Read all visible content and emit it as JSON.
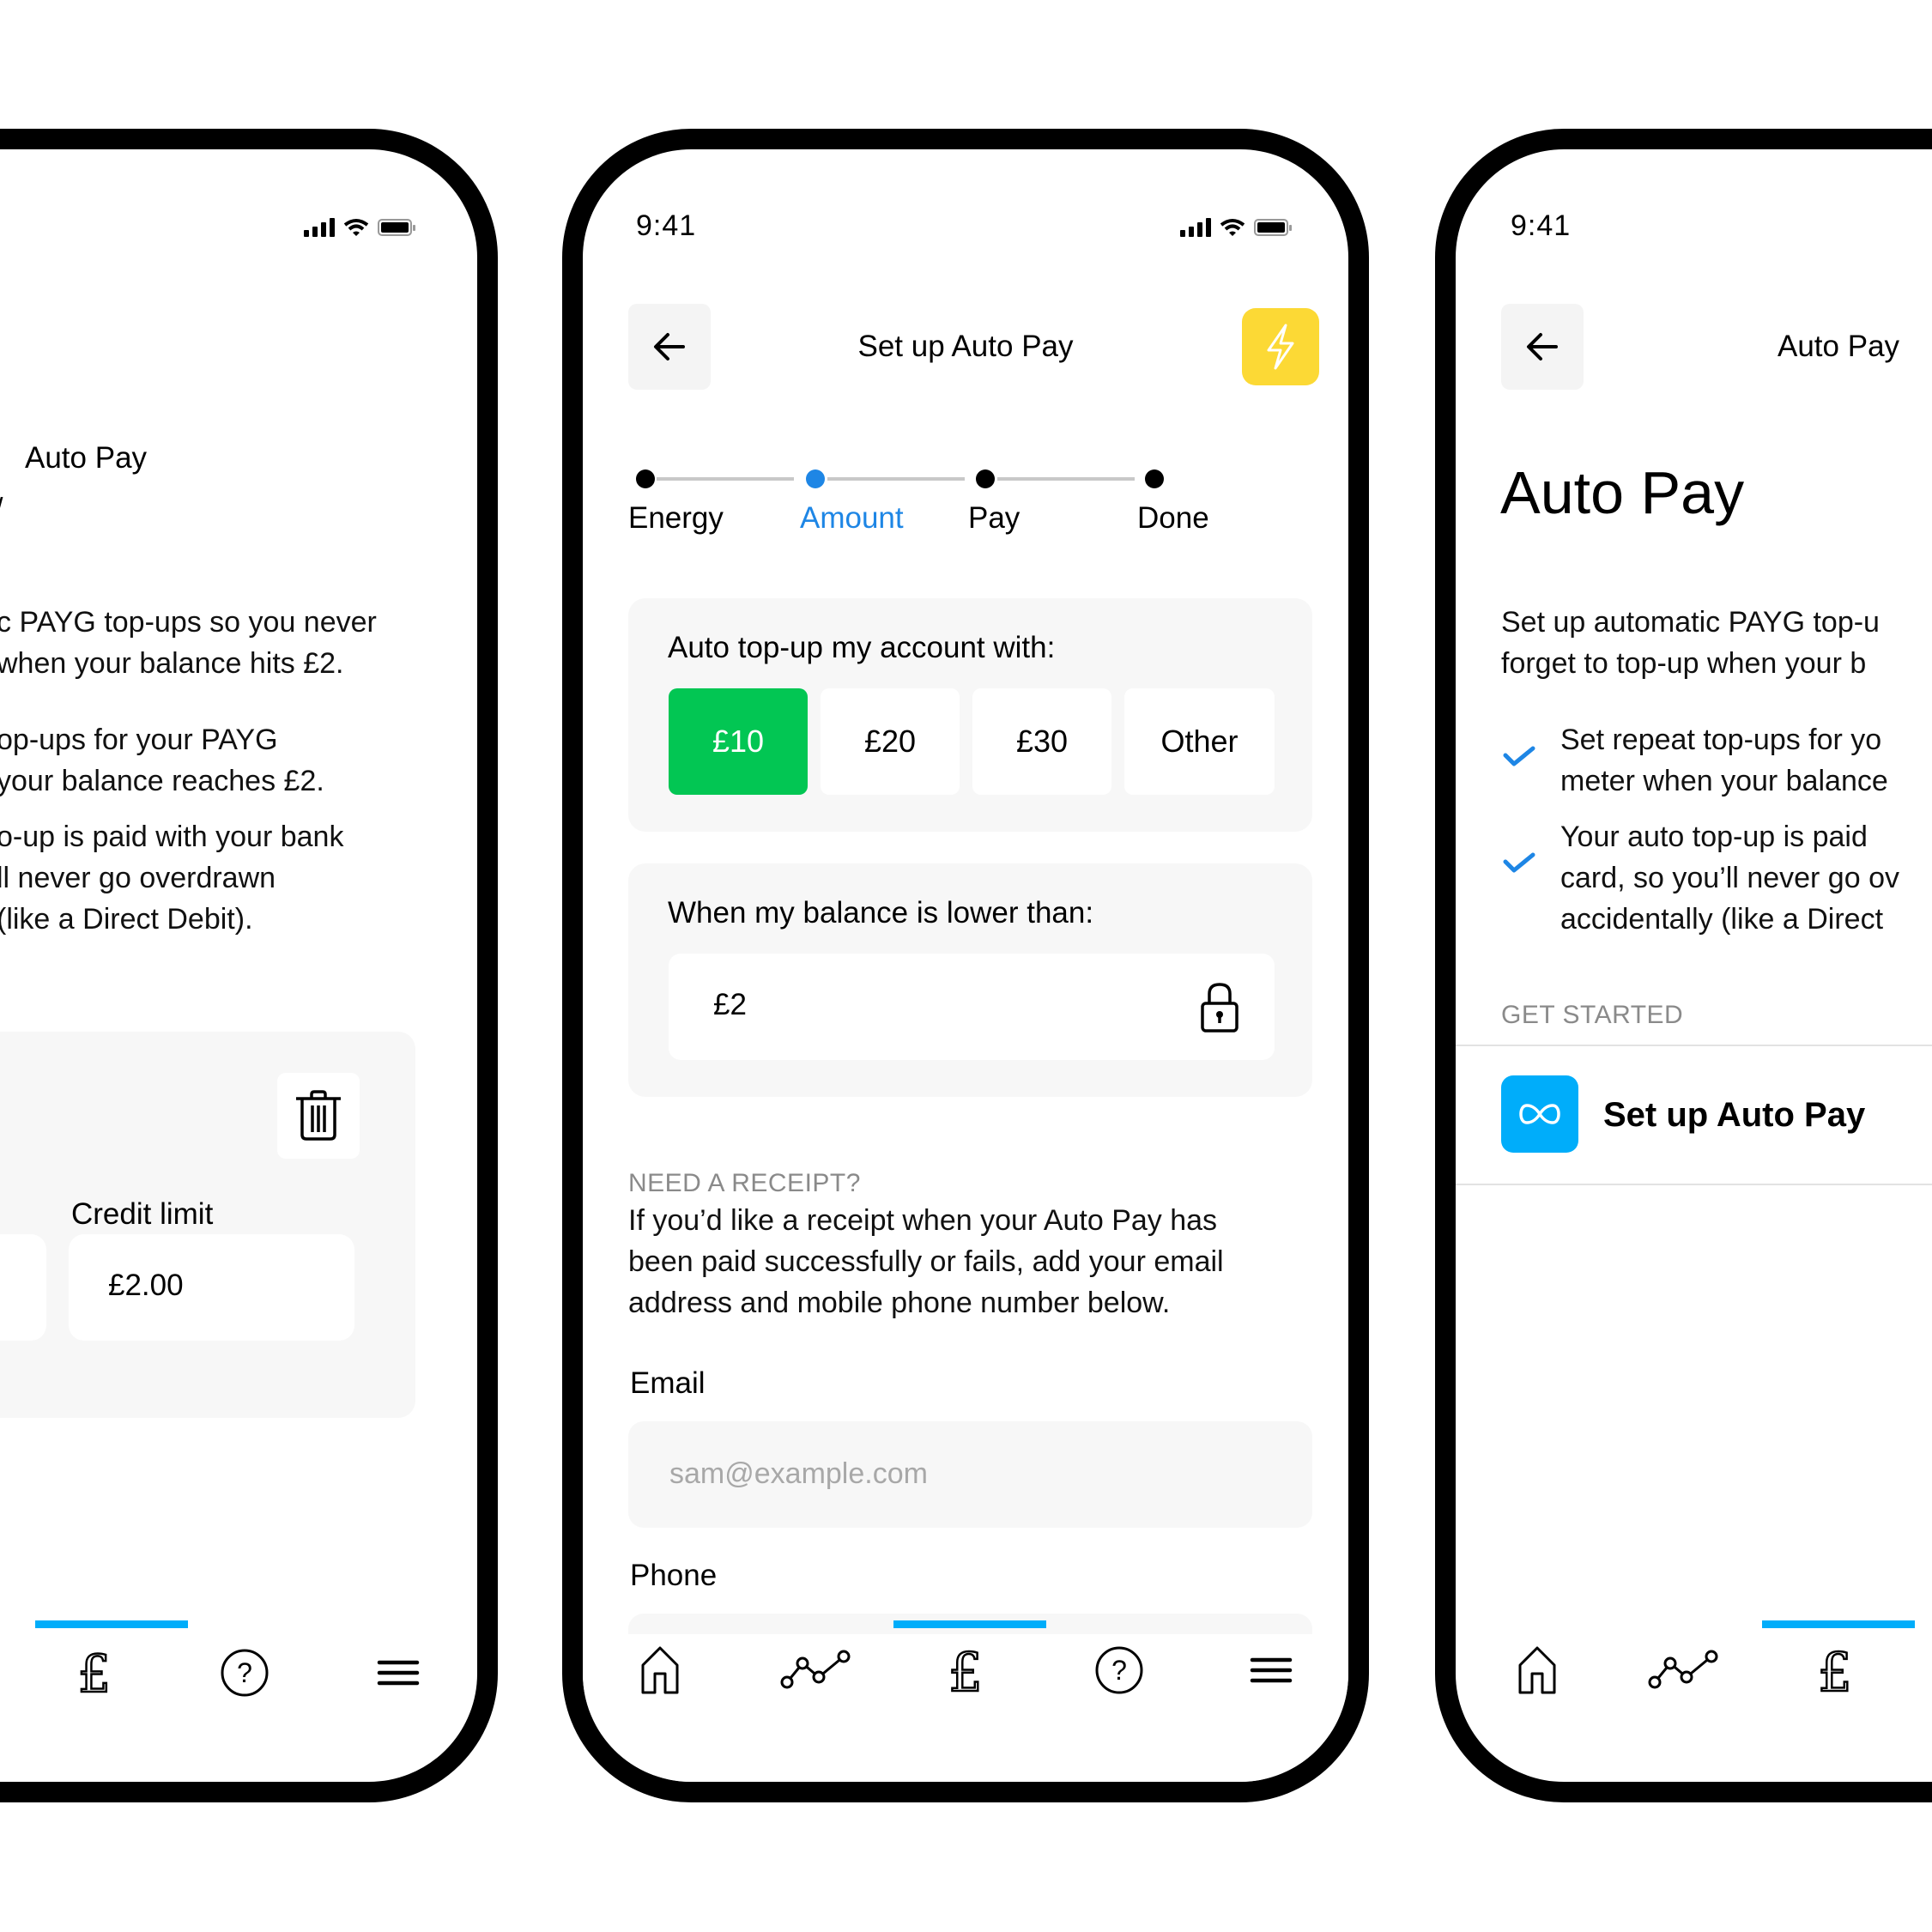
{
  "status_bar": {
    "time": "9:41"
  },
  "left_screen": {
    "title": "Auto Pay",
    "intro_lines": [
      "c PAYG top-ups so you never",
      " when your balance hits £2."
    ],
    "bullet_1_lines": [
      "op-ups for your PAYG",
      "your balance reaches £2."
    ],
    "bullet_2_lines": [
      "o-up is paid with your bank",
      "ll never go overdrawn",
      "(like a Direct Debit)."
    ],
    "credit_limit_label": "Credit limit",
    "credit_limit_value": "£2.00"
  },
  "middle_screen": {
    "title": "Set up Auto Pay",
    "steps": [
      {
        "label": "Energy",
        "state": "done"
      },
      {
        "label": "Amount",
        "state": "active"
      },
      {
        "label": "Pay",
        "state": "pending"
      },
      {
        "label": "Done",
        "state": "pending"
      }
    ],
    "topup_label": "Auto top-up my account with:",
    "amounts": [
      "£10",
      "£20",
      "£30",
      "Other"
    ],
    "selected_amount": "£10",
    "threshold_label": "When my balance is lower than:",
    "threshold_value": "£2",
    "receipt_caption": "NEED A RECEIPT?",
    "receipt_lines": [
      "If you’d like a receipt when your Auto Pay has",
      "been paid successfully or fails, add your email",
      "address and mobile phone number below."
    ],
    "email_label": "Email",
    "email_placeholder": "sam@example.com",
    "phone_label": "Phone"
  },
  "right_screen": {
    "header_title": "Auto Pay",
    "page_title": "Auto Pay",
    "intro_lines": [
      "Set up automatic PAYG top-u",
      "forget to top-up when your b"
    ],
    "bullet_1_lines": [
      "Set repeat top-ups for yo",
      "meter when your balance"
    ],
    "bullet_2_lines": [
      "Your auto top-up is paid",
      "card, so you’ll never go ov",
      "accidentally (like a Direct"
    ],
    "section_caption": "GET STARTED",
    "setup_label": "Set up Auto Pay"
  },
  "nav": {
    "items": [
      "home-icon",
      "usage-chart-icon",
      "pound-icon",
      "help-icon",
      "menu-icon"
    ],
    "active": "pound-icon"
  },
  "colors": {
    "accent_blue": "#1e86e5",
    "selected_green": "#02c653",
    "bolt_yellow": "#fcd935",
    "nav_indicator": "#00adfa"
  }
}
